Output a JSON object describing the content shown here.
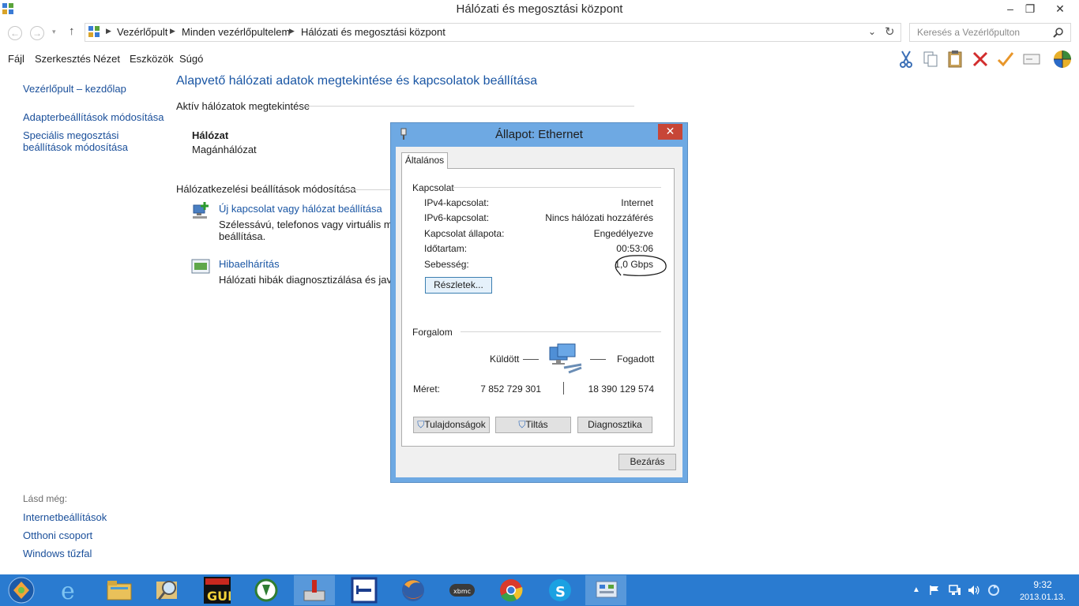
{
  "window": {
    "title": "Hálózati és megosztási központ",
    "minimize": "–",
    "maximize": "❐",
    "close": "✕"
  },
  "nav": {
    "back": "←",
    "forward": "→",
    "up": "↑",
    "refresh": "↻",
    "dropdown": "⌄"
  },
  "breadcrumb": [
    "Vezérlőpult",
    "Minden vezérlőpultelem",
    "Hálózati és megosztási központ"
  ],
  "search": {
    "placeholder": "Keresés a Vezérlőpulton"
  },
  "menu": [
    "Fájl",
    "Szerkesztés",
    "Nézet",
    "Eszközök",
    "Súgó"
  ],
  "sidebar": {
    "home": "Vezérlőpult – kezdőlap",
    "adapter": "Adapterbeállítások módosítása",
    "sharing_line1": "Speciális megosztási",
    "sharing_line2": "beállítások módosítása",
    "see_also_title": "Lásd még:",
    "see_also": [
      "Internetbeállítások",
      "Otthoni csoport",
      "Windows tűzfal"
    ]
  },
  "main": {
    "title": "Alapvető hálózati adatok megtekintése és kapcsolatok beállítása",
    "active_header": "Aktív hálózatok megtekintése",
    "network_name": "Hálózat",
    "network_type": "Magánhálózat",
    "settings_header": "Hálózatkezelési beállítások módosítása",
    "new_conn_link": "Új kapcsolat vagy hálózat beállítása",
    "new_conn_desc1": "Szélessávú, telefonos vagy virtuális magár",
    "new_conn_desc2": "beállítása.",
    "troubleshoot_link": "Hibaelhárítás",
    "troubleshoot_desc": "Hálózati hibák diagnosztizálása és javítás"
  },
  "dialog": {
    "title": "Állapot: Ethernet",
    "close": "✕",
    "tab": "Általános",
    "connection_header": "Kapcsolat",
    "rows": [
      {
        "label": "IPv4-kapcsolat:",
        "value": "Internet"
      },
      {
        "label": "IPv6-kapcsolat:",
        "value": "Nincs hálózati hozzáférés"
      },
      {
        "label": "Kapcsolat állapota:",
        "value": "Engedélyezve"
      },
      {
        "label": "Időtartam:",
        "value": "00:53:06"
      },
      {
        "label": "Sebesség:",
        "value": "1,0 Gbps"
      }
    ],
    "details_button": "Részletek...",
    "activity_header": "Forgalom",
    "sent_label": "Küldött",
    "received_label": "Fogadott",
    "size_label": "Méret:",
    "sent_bytes": "7 852 729 301",
    "received_bytes": "18 390 129 574",
    "properties_button": "Tulajdonságok",
    "disable_button": "Tiltás",
    "diagnose_button": "Diagnosztika",
    "close_button": "Bezárás"
  },
  "taskbar": {
    "apps": [
      "start-icon",
      "internet-explorer-icon",
      "file-explorer-icon",
      "magnifier-icon",
      "exile-gui-icon",
      "download-manager-icon",
      "disk-tool-icon",
      "hotel-icon",
      "firefox-icon",
      "xbmc-icon",
      "chrome-icon",
      "skype-icon",
      "control-panel-icon"
    ],
    "clock_time": "9:32",
    "clock_date": "2013.01.13."
  },
  "colors": {
    "link": "#1a56a4",
    "dialog_frame": "#6ea9e3",
    "taskbar": "#2a7bd0",
    "close_red": "#c74637"
  }
}
